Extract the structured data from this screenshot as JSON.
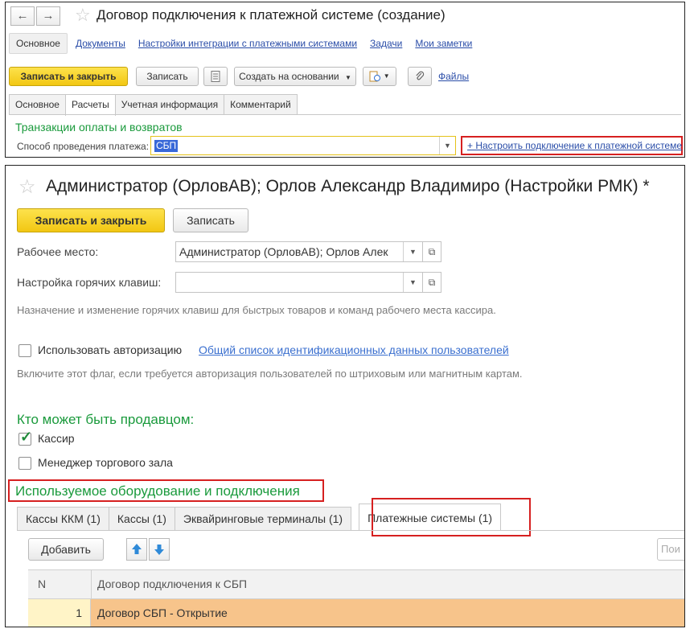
{
  "panel1": {
    "title": "Договор подключения к платежной системе (создание)",
    "nav": {
      "back_icon": "←",
      "forward_icon": "→",
      "items": [
        "Основное",
        "Документы",
        "Настройки интеграции с платежными системами",
        "Задачи",
        "Мои заметки"
      ]
    },
    "toolbar": {
      "save_close": "Записать и закрыть",
      "save": "Записать",
      "create_based": "Создать на основании",
      "files": "Файлы"
    },
    "tabs": [
      "Основное",
      "Расчеты",
      "Учетная информация",
      "Комментарий"
    ],
    "section_title": "Транзакции оплаты и возвратов",
    "payment_method_label": "Способ проведения платежа:",
    "payment_method_value": "СБП",
    "setup_link": "+ Настроить подключение к платежной системе"
  },
  "panel2": {
    "title": "Администратор (ОрловАВ); Орлов Александр Владимиро (Настройки РМК) *",
    "toolbar": {
      "save_close": "Записать и закрыть",
      "save": "Записать"
    },
    "workplace_label": "Рабочее место:",
    "workplace_value": "Администратор (ОрловАВ); Орлов Алек",
    "hotkeys_label": "Настройка горячих клавиш:",
    "hotkeys_value": "",
    "hotkeys_hint": "Назначение и изменение горячих клавиш для быстрых товаров и команд рабочего места кассира.",
    "use_auth_label": "Использовать авторизацию",
    "auth_list_link": "Общий список идентификационных данных пользователей",
    "auth_hint": "Включите этот флаг, если требуется авторизация пользователей по штриховым или магнитным картам.",
    "seller_title": "Кто может быть продавцом:",
    "cashier_label": "Кассир",
    "cashier_checked": true,
    "manager_label": "Менеджер торгового зала",
    "manager_checked": false,
    "equipment_title": "Используемое оборудование и подключения",
    "tabs": [
      "Кассы ККМ (1)",
      "Кассы (1)",
      "Эквайринговые терминалы (1)",
      "Платежные системы (1)"
    ],
    "add_button": "Добавить",
    "search_placeholder": "Пои",
    "table": {
      "headers": [
        "N",
        "Договор подключения к СБП"
      ],
      "rows": [
        {
          "n": "1",
          "contract": "Договор СБП - Открытие"
        }
      ]
    }
  },
  "colors": {
    "accent_green": "#1a9a3c",
    "primary_button": "#f2c713",
    "highlight_red": "#d62020",
    "selected_row": "#f7c48b"
  }
}
